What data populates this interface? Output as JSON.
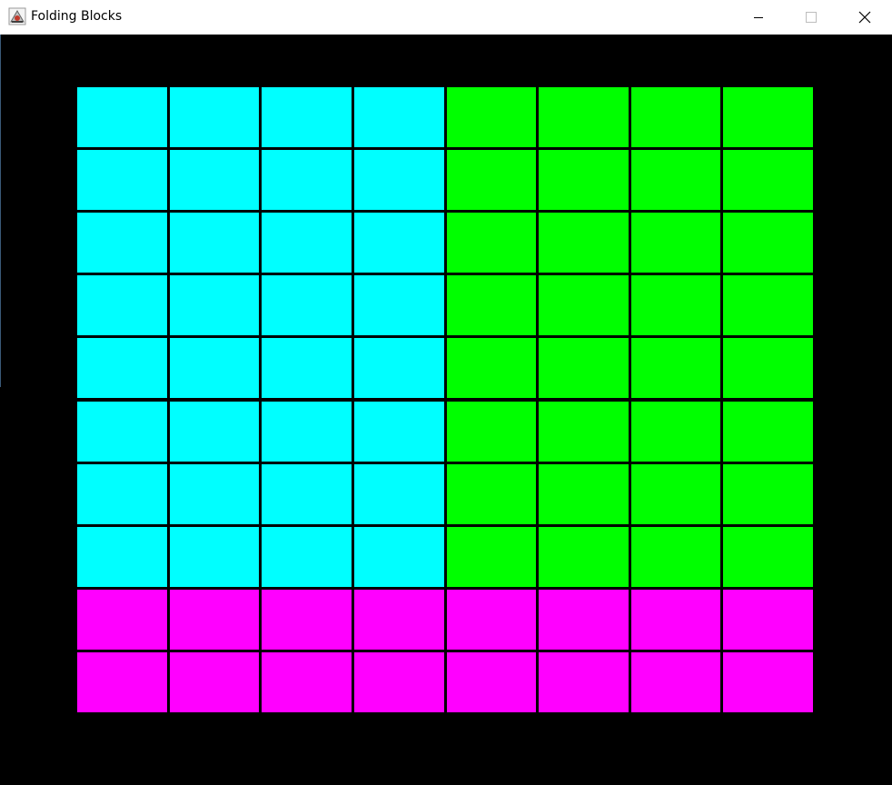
{
  "window": {
    "title": "Folding Blocks",
    "icon": "java-app-icon",
    "controls": {
      "minimize": "minimize-icon",
      "maximize": "maximize-icon",
      "close": "close-icon"
    }
  },
  "colors": {
    "background": "#000000",
    "cyan": "#00ffff",
    "green": "#00ff00",
    "magenta": "#ff00ff",
    "grid_line": "#000000"
  },
  "board": {
    "columns": 8,
    "rows": 10,
    "grid": [
      [
        "cyan",
        "cyan",
        "cyan",
        "cyan",
        "green",
        "green",
        "green",
        "green"
      ],
      [
        "cyan",
        "cyan",
        "cyan",
        "cyan",
        "green",
        "green",
        "green",
        "green"
      ],
      [
        "cyan",
        "cyan",
        "cyan",
        "cyan",
        "green",
        "green",
        "green",
        "green"
      ],
      [
        "cyan",
        "cyan",
        "cyan",
        "cyan",
        "green",
        "green",
        "green",
        "green"
      ],
      [
        "cyan",
        "cyan",
        "cyan",
        "cyan",
        "green",
        "green",
        "green",
        "green"
      ],
      [
        "cyan",
        "cyan",
        "cyan",
        "cyan",
        "green",
        "green",
        "green",
        "green"
      ],
      [
        "cyan",
        "cyan",
        "cyan",
        "cyan",
        "green",
        "green",
        "green",
        "green"
      ],
      [
        "cyan",
        "cyan",
        "cyan",
        "cyan",
        "green",
        "green",
        "green",
        "green"
      ],
      [
        "magenta",
        "magenta",
        "magenta",
        "magenta",
        "magenta",
        "magenta",
        "magenta",
        "magenta"
      ],
      [
        "magenta",
        "magenta",
        "magenta",
        "magenta",
        "magenta",
        "magenta",
        "magenta",
        "magenta"
      ]
    ]
  }
}
